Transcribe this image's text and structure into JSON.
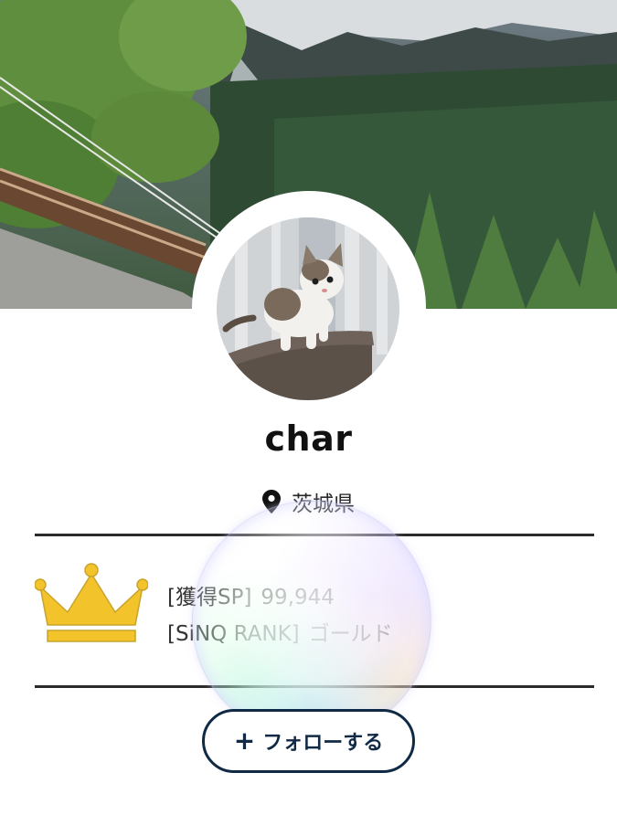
{
  "profile": {
    "username": "char",
    "location": "茨城県",
    "avatar_alt": "kitten-photo"
  },
  "stats": {
    "sp_label": "[獲得SP]",
    "sp_value": "99,944",
    "rank_label": "[SiNQ RANK]",
    "rank_value": "ゴールド"
  },
  "follow_button": {
    "icon": "+",
    "label": "フォローする"
  },
  "colors": {
    "crown": "#f2c32b",
    "button_border": "#102a45",
    "divider": "#2b2b2b"
  },
  "icons": {
    "location": "location-pin-icon",
    "rank": "crown-icon",
    "follow": "plus-icon"
  }
}
